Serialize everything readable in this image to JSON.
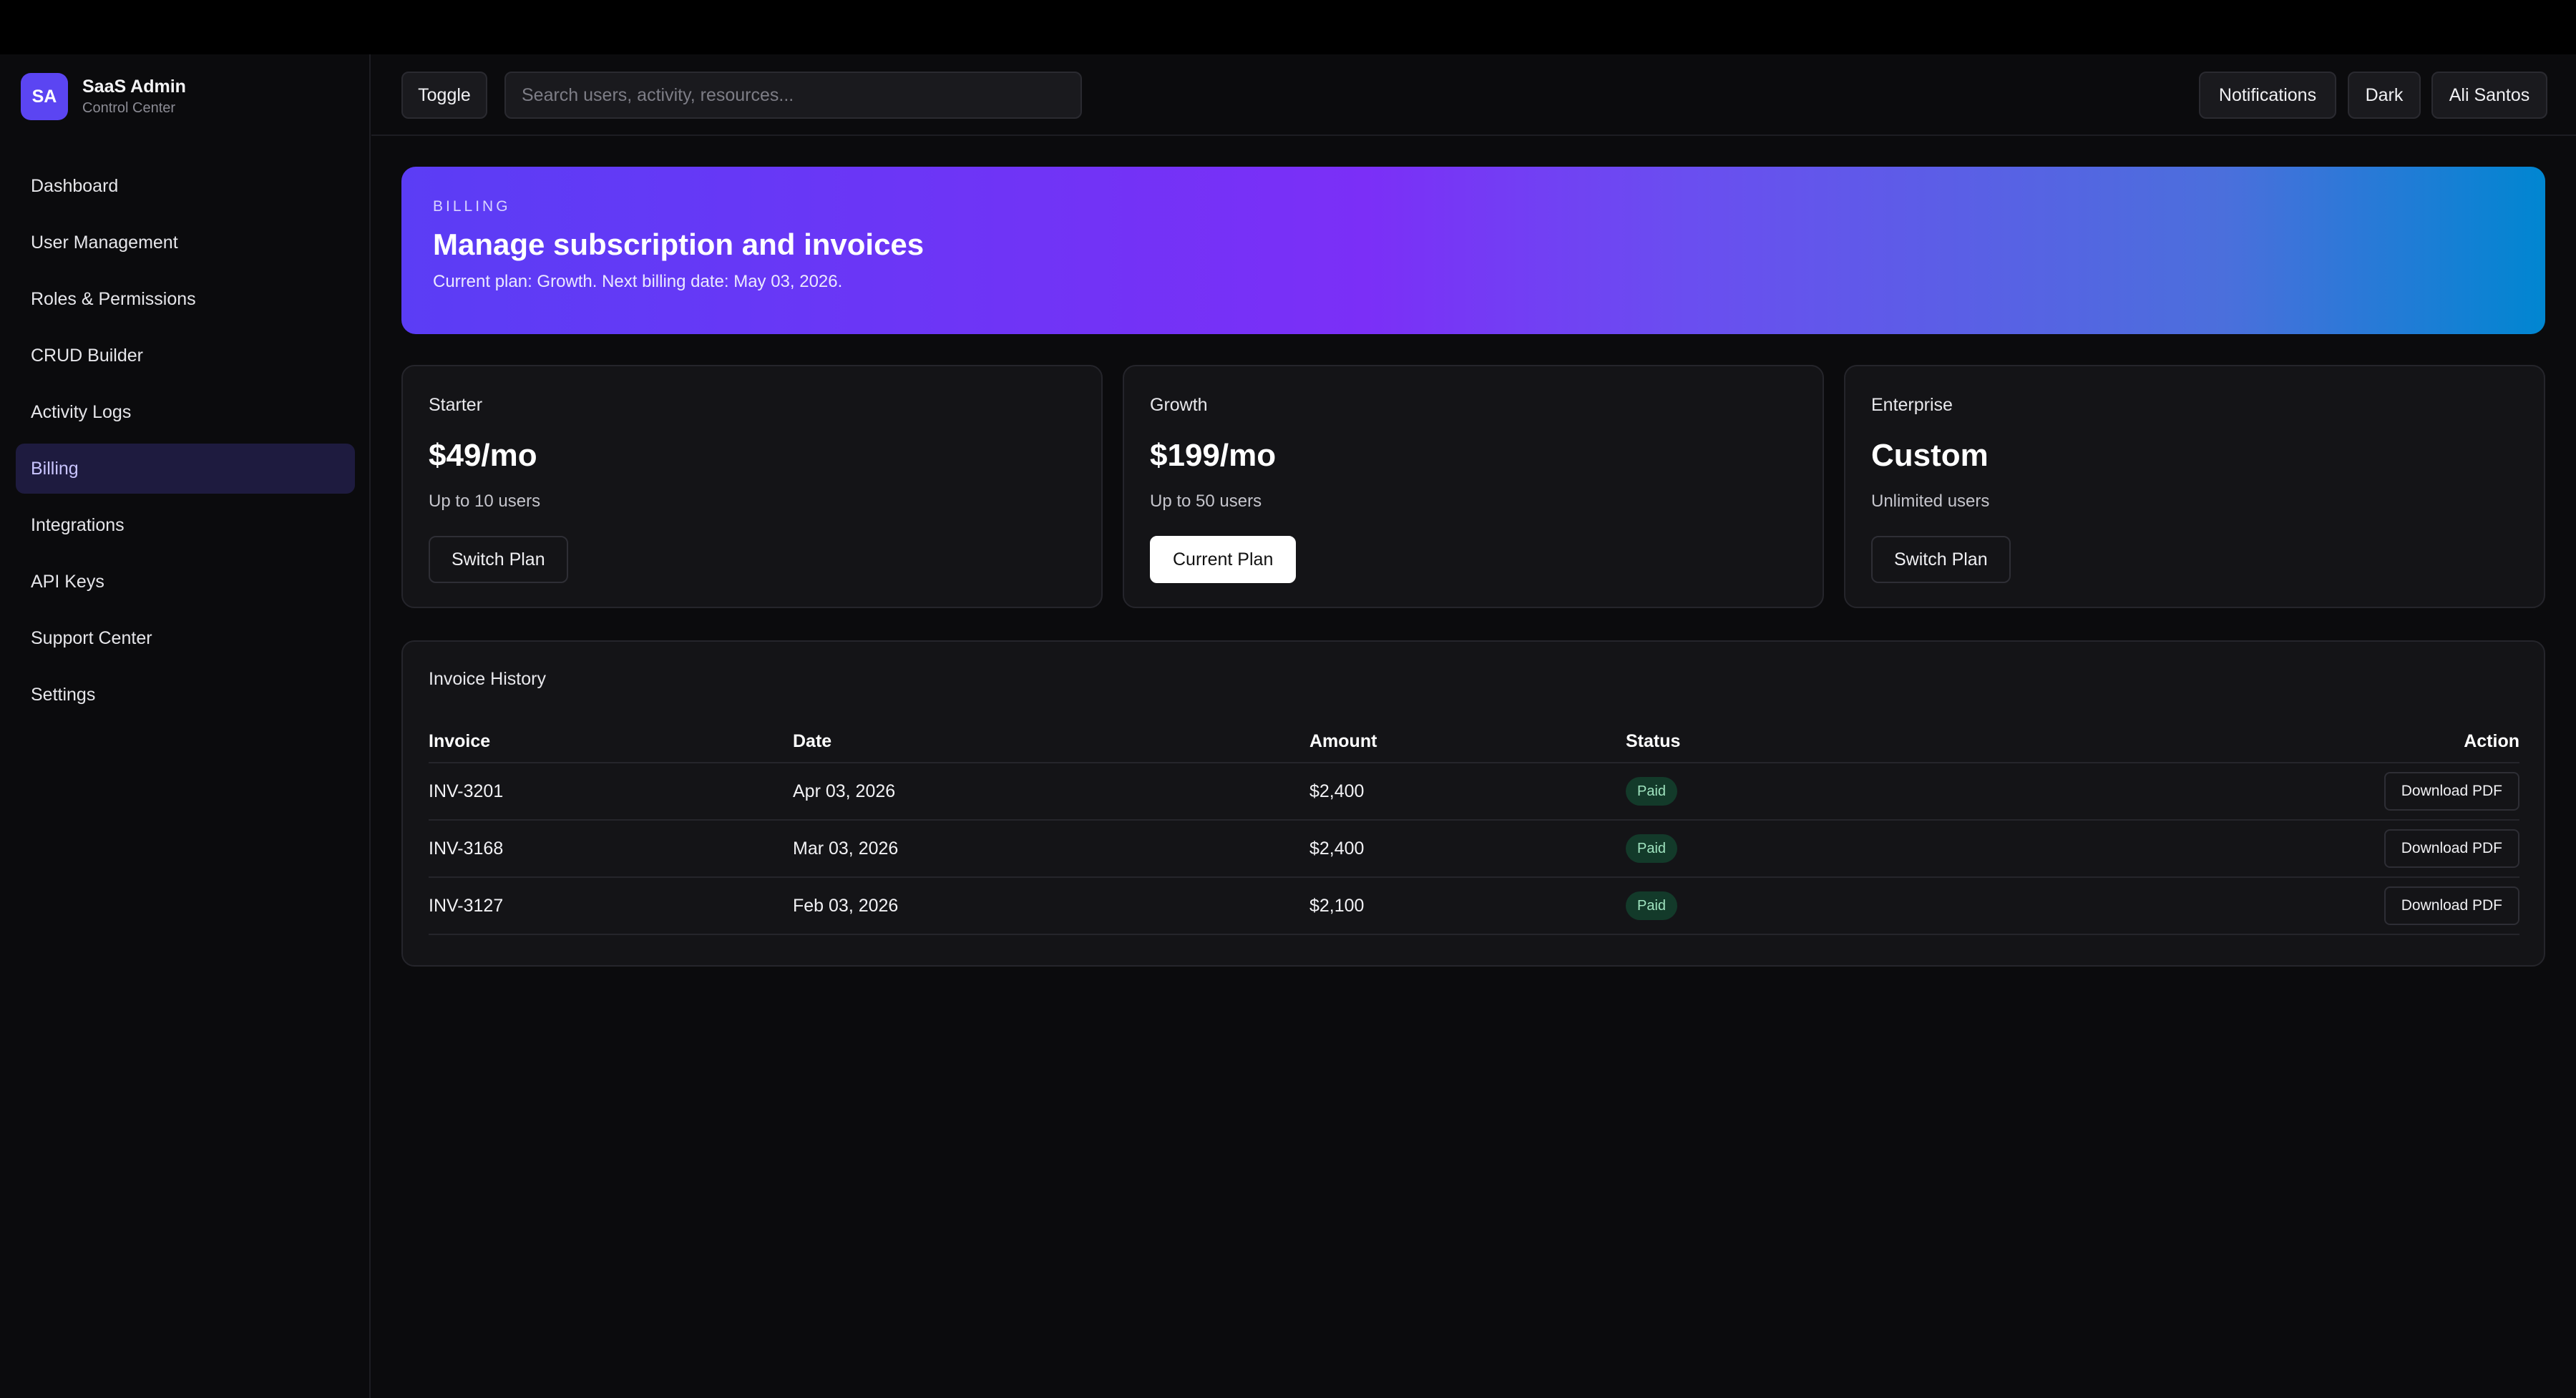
{
  "brand": {
    "logo": "SA",
    "name": "SaaS Admin",
    "subtitle": "Control Center"
  },
  "sidebar": {
    "items": [
      {
        "label": "Dashboard",
        "active": false
      },
      {
        "label": "User Management",
        "active": false
      },
      {
        "label": "Roles & Permissions",
        "active": false
      },
      {
        "label": "CRUD Builder",
        "active": false
      },
      {
        "label": "Activity Logs",
        "active": false
      },
      {
        "label": "Billing",
        "active": true
      },
      {
        "label": "Integrations",
        "active": false
      },
      {
        "label": "API Keys",
        "active": false
      },
      {
        "label": "Support Center",
        "active": false
      },
      {
        "label": "Settings",
        "active": false
      }
    ]
  },
  "header": {
    "toggle_label": "Toggle",
    "search_placeholder": "Search users, activity, resources...",
    "notifications_label": "Notifications",
    "theme_label": "Dark",
    "user_label": "Ali Santos"
  },
  "hero": {
    "kicker": "BILLING",
    "title": "Manage subscription and invoices",
    "subtitle": "Current plan: Growth. Next billing date: May 03, 2026."
  },
  "plans": [
    {
      "name": "Starter",
      "price": "$49/mo",
      "users": "Up to 10 users",
      "button": "Switch Plan",
      "current": false
    },
    {
      "name": "Growth",
      "price": "$199/mo",
      "users": "Up to 50 users",
      "button": "Current Plan",
      "current": true
    },
    {
      "name": "Enterprise",
      "price": "Custom",
      "users": "Unlimited users",
      "button": "Switch Plan",
      "current": false
    }
  ],
  "invoices": {
    "title": "Invoice History",
    "columns": [
      "Invoice",
      "Date",
      "Amount",
      "Status",
      "Action"
    ],
    "rows": [
      {
        "invoice": "INV-3201",
        "date": "Apr 03, 2026",
        "amount": "$2,400",
        "status": "Paid",
        "action": "Download PDF"
      },
      {
        "invoice": "INV-3168",
        "date": "Mar 03, 2026",
        "amount": "$2,400",
        "status": "Paid",
        "action": "Download PDF"
      },
      {
        "invoice": "INV-3127",
        "date": "Feb 03, 2026",
        "amount": "$2,100",
        "status": "Paid",
        "action": "Download PDF"
      }
    ]
  },
  "colors": {
    "accent": "#5b45f2",
    "active_nav_bg": "#1e1b3f",
    "paid_badge_bg": "#133a2a",
    "paid_badge_text": "#9fe3bf"
  }
}
